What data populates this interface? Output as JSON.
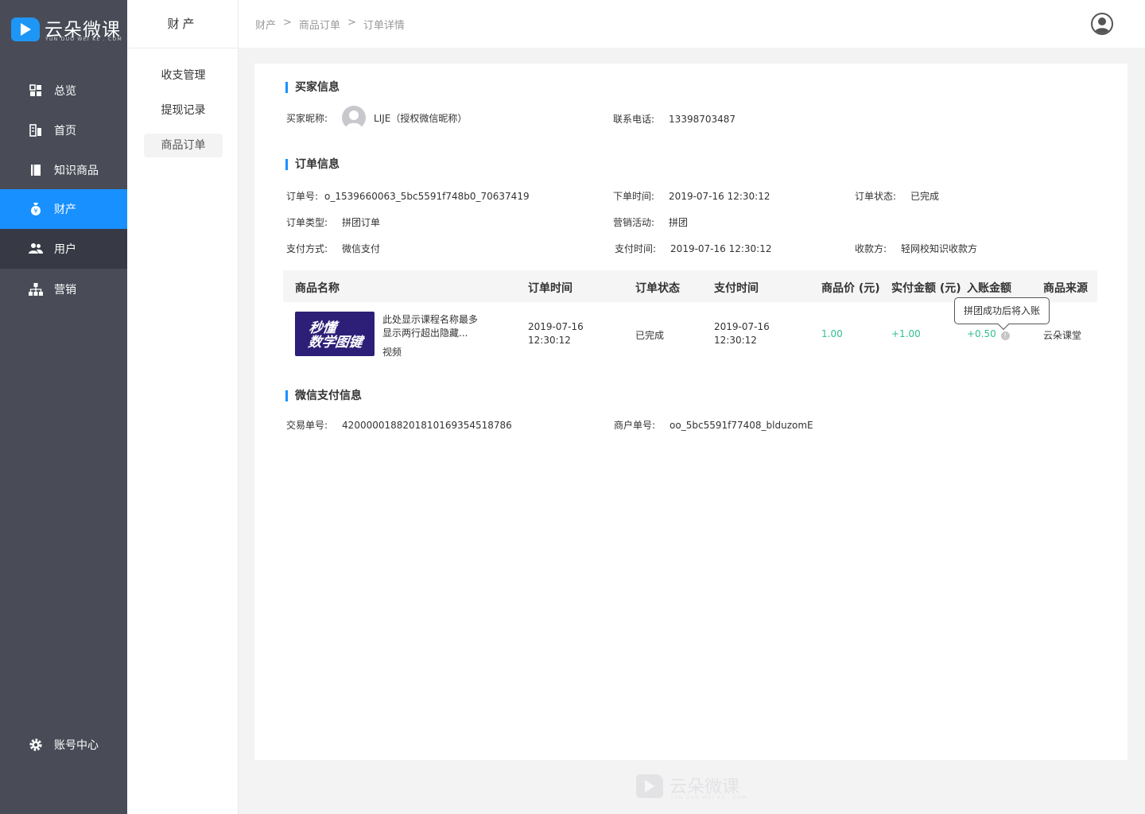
{
  "brand": {
    "name": "云朵微课",
    "sub": "YUN DUO WEI KE . COM"
  },
  "nav": {
    "items": [
      {
        "label": "总览",
        "icon": "dashboard-icon"
      },
      {
        "label": "首页",
        "icon": "home-icon"
      },
      {
        "label": "知识商品",
        "icon": "book-icon"
      },
      {
        "label": "财产",
        "icon": "money-bag-icon"
      },
      {
        "label": "用户",
        "icon": "users-icon"
      },
      {
        "label": "营销",
        "icon": "org-chart-icon"
      }
    ],
    "account": {
      "label": "账号中心",
      "icon": "gear-icon"
    },
    "active_color": "#1890ff"
  },
  "subnav": {
    "title": "财产",
    "items": [
      "收支管理",
      "提现记录",
      "商品订单"
    ]
  },
  "breadcrumb": [
    "财产",
    ">",
    "商品订单",
    ">",
    "订单详情"
  ],
  "buyer": {
    "section_title": "买家信息",
    "nickname_label": "买家昵称:",
    "nickname": "LIJE（授权微信昵称）",
    "phone_label": "联系电话:",
    "phone": "13398703487"
  },
  "order": {
    "section_title": "订单信息",
    "id_label": "订单号:",
    "id": "o_1539660063_5bc5591f748b0_70637419",
    "created_label": "下单时间:",
    "created": "2019-07-16 12:30:12",
    "status_label": "订单状态:",
    "status": "已完成",
    "type_label": "订单类型:",
    "type": "拼团订单",
    "campaign_label": "营销活动:",
    "campaign": "拼团",
    "pay_method_label": "支付方式:",
    "pay_method": "微信支付",
    "paid_label": "支付时间:",
    "paid": "2019-07-16 12:30:12",
    "payee_label": "收款方:",
    "payee": "轻网校知识收款方"
  },
  "table": {
    "headers": [
      "商品名称",
      "订单时间",
      "订单状态",
      "支付时间",
      "商品价 (元)",
      "实付金额 (元)",
      "入账金额",
      "商品来源"
    ],
    "row": {
      "thumb_line1": "秒懂",
      "thumb_line2": "数学图键",
      "name_line1": "此处显示课程名称最多",
      "name_line2": "显示两行超出隐藏...",
      "kind": "视频",
      "order_date": "2019-07-16",
      "order_time": "12:30:12",
      "status": "已完成",
      "pay_date": "2019-07-16",
      "pay_time": "12:30:12",
      "price": "1.00",
      "paid": "+1.00",
      "income": "+0.50",
      "source": "云朵课堂"
    },
    "tooltip": "拼团成功后将入账"
  },
  "wechat": {
    "section_title": "微信支付信息",
    "trade_label": "交易单号:",
    "trade": "4200000188201810169354518786",
    "merchant_label": "商户单号:",
    "merchant": "oo_5bc5591f77408_blduzomE"
  }
}
